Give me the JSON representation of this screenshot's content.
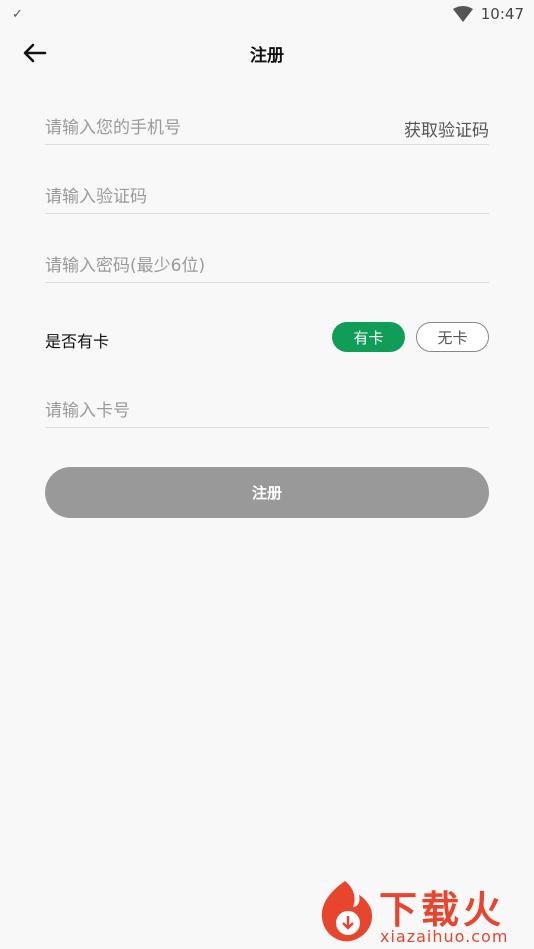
{
  "status_bar": {
    "left_icon": "check-icon",
    "time": "10:47"
  },
  "header": {
    "title": "注册"
  },
  "form": {
    "phone_placeholder": "请输入您的手机号",
    "get_code_label": "获取验证码",
    "code_placeholder": "请输入验证码",
    "password_placeholder": "请输入密码(最少6位)",
    "has_card_label": "是否有卡",
    "has_card_yes": "有卡",
    "has_card_no": "无卡",
    "has_card_selected": "有卡",
    "card_placeholder": "请输入卡号",
    "submit_label": "注册"
  },
  "watermark": {
    "brand": "下载火",
    "url": "xiazaihuo.com"
  },
  "colors": {
    "accent": "#0f9d58",
    "button_disabled": "#999999",
    "watermark": "#e8452e"
  }
}
